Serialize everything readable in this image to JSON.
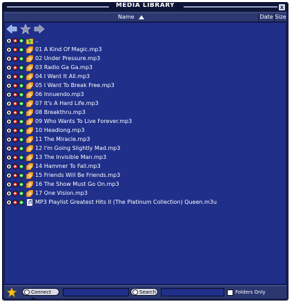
{
  "window": {
    "title": "MEDIA LIBRARY",
    "close_glyph": "x"
  },
  "columns": {
    "name": "Name",
    "date": "Date",
    "size": "Size"
  },
  "colors": {
    "background": "#1f2f8a",
    "text": "#ffffff",
    "title_bg": "#0d1436"
  },
  "rows": [
    {
      "label": "..",
      "icon": "folder-up-icon"
    },
    {
      "label": "01 A Kind Of Magic.mp3",
      "icon": "audio-file-icon"
    },
    {
      "label": "02 Under Pressure.mp3",
      "icon": "audio-file-icon"
    },
    {
      "label": "03 Radio Ga Ga.mp3",
      "icon": "audio-file-icon"
    },
    {
      "label": "04 I Want It All.mp3",
      "icon": "audio-file-icon"
    },
    {
      "label": "05 I Want To Break Free.mp3",
      "icon": "audio-file-icon"
    },
    {
      "label": "06 Innuendo.mp3",
      "icon": "audio-file-icon"
    },
    {
      "label": "07 It's A Hard Life.mp3",
      "icon": "audio-file-icon"
    },
    {
      "label": "08 Breakthru.mp3",
      "icon": "audio-file-icon"
    },
    {
      "label": "09 Who Wants To Live Forever.mp3",
      "icon": "audio-file-icon"
    },
    {
      "label": "10 Headlong.mp3",
      "icon": "audio-file-icon"
    },
    {
      "label": "11 The Miracle.mp3",
      "icon": "audio-file-icon"
    },
    {
      "label": "12 I'm Going Slightly Mad.mp3",
      "icon": "audio-file-icon"
    },
    {
      "label": "13 The Invisible Man.mp3",
      "icon": "audio-file-icon"
    },
    {
      "label": "14 Hammer To Fall.mp3",
      "icon": "audio-file-icon"
    },
    {
      "label": "15 Friends Will Be Friends.mp3",
      "icon": "audio-file-icon"
    },
    {
      "label": "16 The Show Must Go On.mp3",
      "icon": "audio-file-icon"
    },
    {
      "label": "17 One Vision.mp3",
      "icon": "audio-file-icon"
    },
    {
      "label": "MP3 Playlist Greatest Hits II (The Platinum Collection) Queen.m3u",
      "icon": "playlist-file-icon"
    }
  ],
  "bottom": {
    "connect_label": "Connect To",
    "search_label": "Search",
    "folders_only_label": "Folders Only"
  }
}
